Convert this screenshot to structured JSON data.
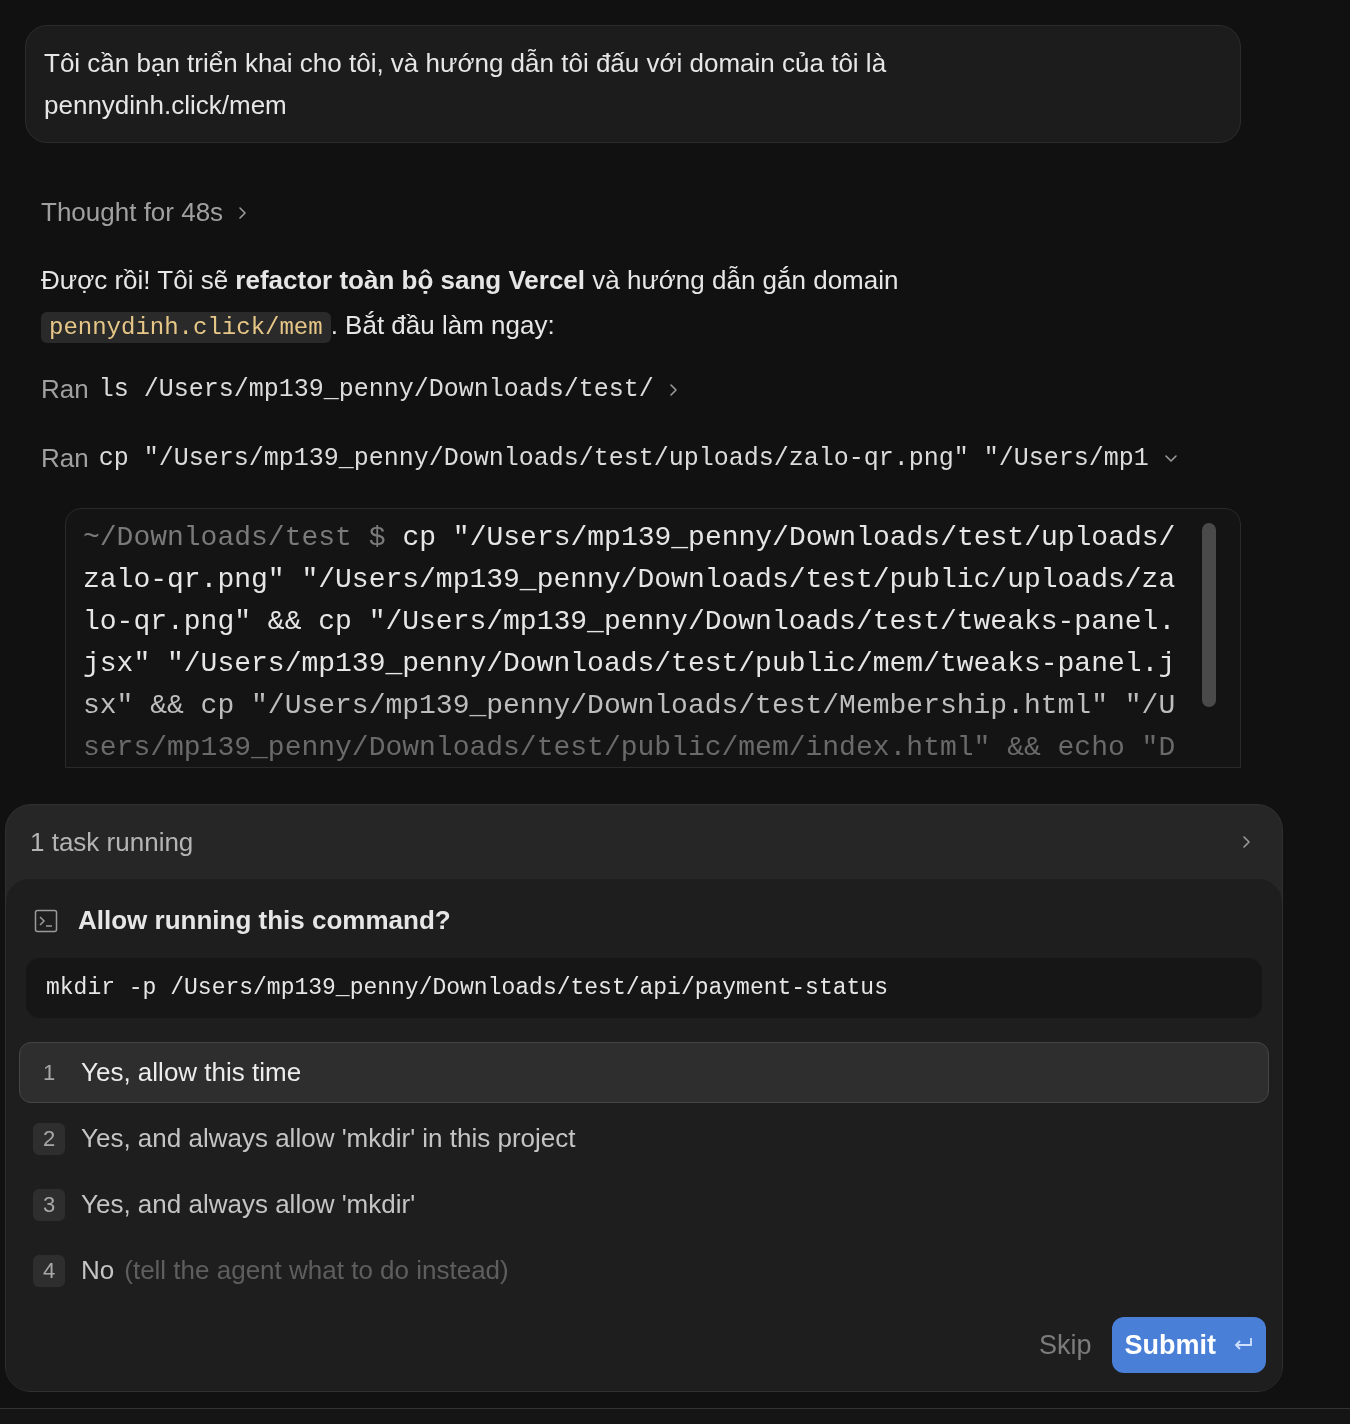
{
  "user_message": "Tôi cần bạn triển khai cho tôi, và hướng dẫn tôi đấu với domain của tôi là pennydinh.click/mem",
  "thought": {
    "label": "Thought for 48s",
    "expanded": false
  },
  "assistant_message": {
    "before": "Được rồi! Tôi sẽ **refactor toàn bộ sang Vercel** và hướng dẫn gắn domain",
    "code": "pennydinh.click/mem",
    "after": ". Bắt đầu làm ngay:"
  },
  "tool_calls": [
    {
      "label": "Ran",
      "command": "ls /Users/mp139_penny/Downloads/test/",
      "expanded": false
    },
    {
      "label": "Ran",
      "command": "cp \"/Users/mp139_penny/Downloads/test/uploads/zalo-qr.png\" \"/Users/mp1",
      "expanded": true
    }
  ],
  "terminal": {
    "prompt": "~/Downloads/test $",
    "lines": [
      "cp \"/Users/mp139_penny/Downloads/test/uploads/",
      "zalo-qr.png\" \"/Users/mp139_penny/Downloads/test/public/uploads/za",
      "lo-qr.png\" && cp \"/Users/mp139_penny/Downloads/test/tweaks-panel.",
      "jsx\" \"/Users/mp139_penny/Downloads/test/public/mem/tweaks-panel.j",
      "sx\" && cp \"/Users/mp139_penny/Downloads/test/Membership.html\" \"/U",
      "sers/mp139_penny/Downloads/test/public/mem/index.html\" && echo \"D"
    ]
  },
  "tasks": {
    "label": "1 task running"
  },
  "permission": {
    "title": "Allow running this command?",
    "command": "mkdir -p /Users/mp139_penny/Downloads/test/api/payment-status",
    "options": [
      {
        "number": "1",
        "label": "Yes, allow this time",
        "selected": true
      },
      {
        "number": "2",
        "label": "Yes, and always allow 'mkdir' in this project",
        "selected": false
      },
      {
        "number": "3",
        "label": "Yes, and always allow 'mkdir'",
        "selected": false
      },
      {
        "number": "4",
        "label": "No",
        "hint": "(tell the agent what to do instead)",
        "selected": false
      }
    ],
    "skip": "Skip",
    "submit": "Submit"
  }
}
